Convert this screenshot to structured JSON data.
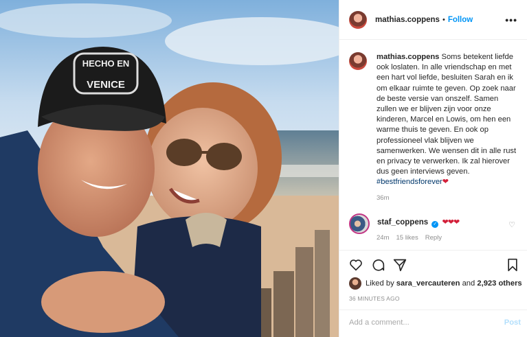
{
  "header": {
    "username": "mathias.coppens",
    "separator": "•",
    "follow_label": "Follow",
    "more_label": "•••"
  },
  "photo": {
    "cap_text_line1": "HECHO EN",
    "cap_text_line2": "VENICE"
  },
  "caption": {
    "username": "mathias.coppens",
    "text": "Soms betekent liefde ook loslaten. In alle vriendschap en met een hart vol liefde, besluiten Sarah en ik om elkaar ruimte te geven. Op zoek naar de beste versie van onszelf. Samen zullen we er blijven zijn voor onze kinderen, Marcel en Lowis, om hen een warme thuis te geven. En ook op professioneel vlak blijven we samenwerken. We wensen dit in alle rust en privacy te verwerken. Ik zal hierover dus geen interviews geven.",
    "hashtag": "#bestfriendsforever",
    "emoji": "❤",
    "time": "36m"
  },
  "comment": {
    "username": "staf_coppens",
    "verified_mark": "✓",
    "hearts": "❤❤❤",
    "time": "24m",
    "likes": "15 likes",
    "reply_label": "Reply",
    "like_icon": "♡"
  },
  "likes": {
    "prefix": "Liked by",
    "user": "sara_vercauteren",
    "conj": "and",
    "others": "2,923 others"
  },
  "posted": "36 MINUTES AGO",
  "add_comment": {
    "placeholder": "Add a comment...",
    "post_label": "Post"
  }
}
